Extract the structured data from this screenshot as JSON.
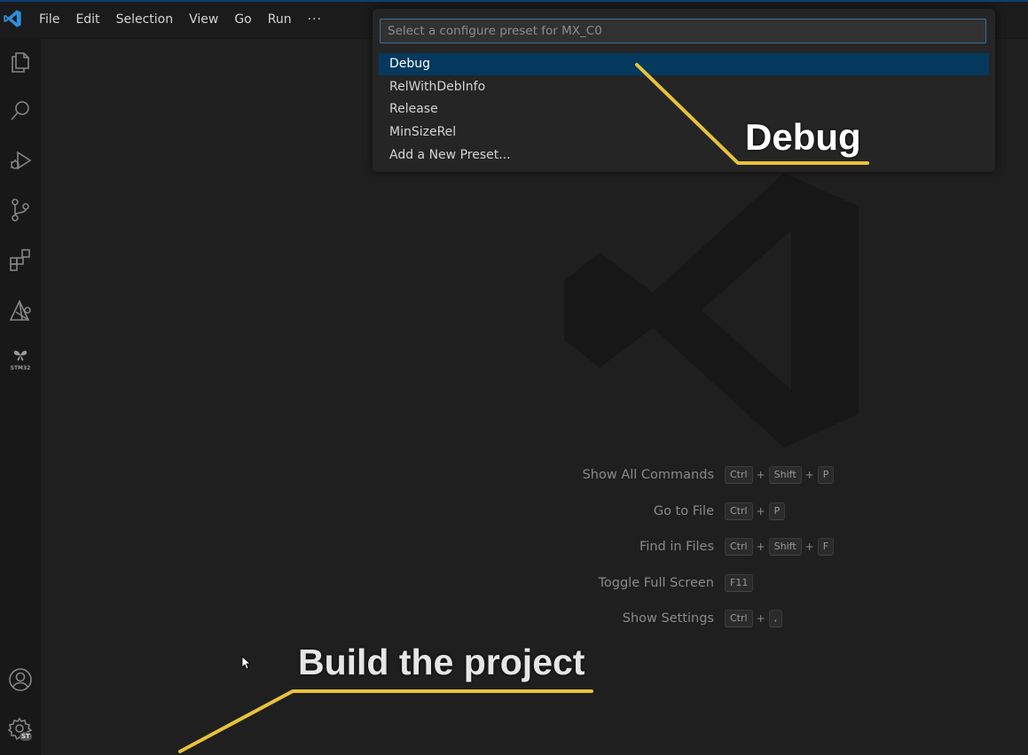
{
  "menu": {
    "items": [
      "File",
      "Edit",
      "Selection",
      "View",
      "Go",
      "Run"
    ],
    "more": "···"
  },
  "activity_bar": {
    "icons": [
      "explorer-icon",
      "search-icon",
      "run-debug-icon",
      "source-control-icon",
      "extensions-icon",
      "cmake-icon",
      "stm32-icon",
      "account-icon",
      "settings-gear-icon"
    ],
    "stm32_label": "STM32",
    "settings_badge": "ST"
  },
  "quick_pick": {
    "placeholder": "Select a configure preset for MX_C0",
    "items": [
      {
        "label": "Debug",
        "selected": true
      },
      {
        "label": "RelWithDebInfo",
        "selected": false
      },
      {
        "label": "Release",
        "selected": false
      },
      {
        "label": "MinSizeRel",
        "selected": false
      },
      {
        "label": "Add a New Preset...",
        "selected": false
      }
    ]
  },
  "shortcuts": [
    {
      "label": "Show All Commands",
      "keys": [
        "Ctrl",
        "Shift",
        "P"
      ]
    },
    {
      "label": "Go to File",
      "keys": [
        "Ctrl",
        "P"
      ]
    },
    {
      "label": "Find in Files",
      "keys": [
        "Ctrl",
        "Shift",
        "F"
      ]
    },
    {
      "label": "Toggle Full Screen",
      "keys": [
        "F11"
      ]
    },
    {
      "label": "Show Settings",
      "keys": [
        "Ctrl",
        ","
      ]
    }
  ],
  "annotations": {
    "debug_callout": "Debug",
    "build_callout": "Build the project"
  },
  "colors": {
    "accent_blue": "#0078d4",
    "selection": "#04395e",
    "annotation_line": "#e8c23a"
  }
}
